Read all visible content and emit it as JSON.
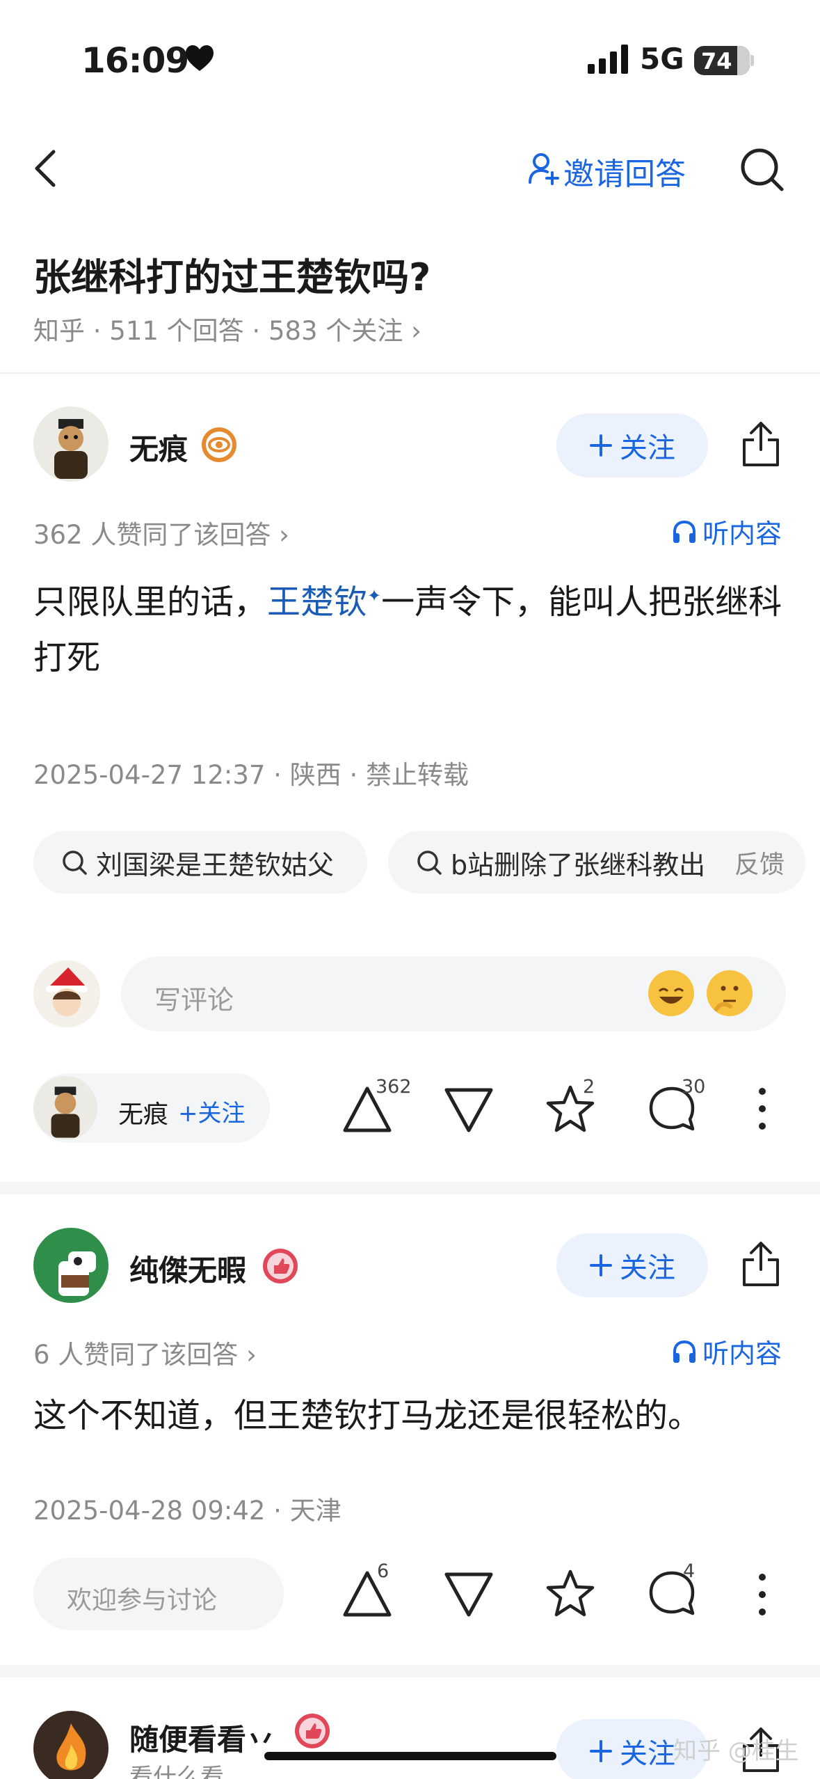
{
  "status_bar": {
    "time": "16:09",
    "network": "5G",
    "battery": "74"
  },
  "header": {
    "invite_label": "邀请回答",
    "accent_color": "#1a66e0"
  },
  "question": {
    "title": "张继科打的过王楚钦吗?",
    "meta": "知乎 · 511 个回答 · 583 个关注 ›"
  },
  "answers": [
    {
      "author": "无痕",
      "follow_label": "关注",
      "votes_line": "362 人赞同了该回答 ›",
      "listen_label": "听内容",
      "text_before": "只限队里的话，",
      "text_link": "王楚钦",
      "text_after": "一声令下，能叫人把张继科打死",
      "date_line": "2025-04-27 12:37 · 陕西 · 禁止转载",
      "related": [
        "刘国梁是王楚钦姑父",
        "b站删除了张继科教出"
      ],
      "feedback_label": "反馈",
      "comment_placeholder": "写评论",
      "chip_name": "无痕",
      "chip_follow": "+关注",
      "counts": {
        "upvote": "362",
        "favorite": "2",
        "comments": "30"
      }
    },
    {
      "author": "纯傑无暇",
      "follow_label": "关注",
      "votes_line": "6 人赞同了该回答 ›",
      "listen_label": "听内容",
      "text": "这个不知道，但王楚钦打马龙还是很轻松的。",
      "date_line": "2025-04-28 09:42 · 天津",
      "discuss_placeholder": "欢迎参与讨论",
      "counts": {
        "upvote": "6",
        "comments": "4"
      }
    },
    {
      "author": "随便看看丷",
      "subtitle": "看什么看",
      "follow_label": "关注"
    }
  ],
  "watermark": "知乎 @桂生"
}
